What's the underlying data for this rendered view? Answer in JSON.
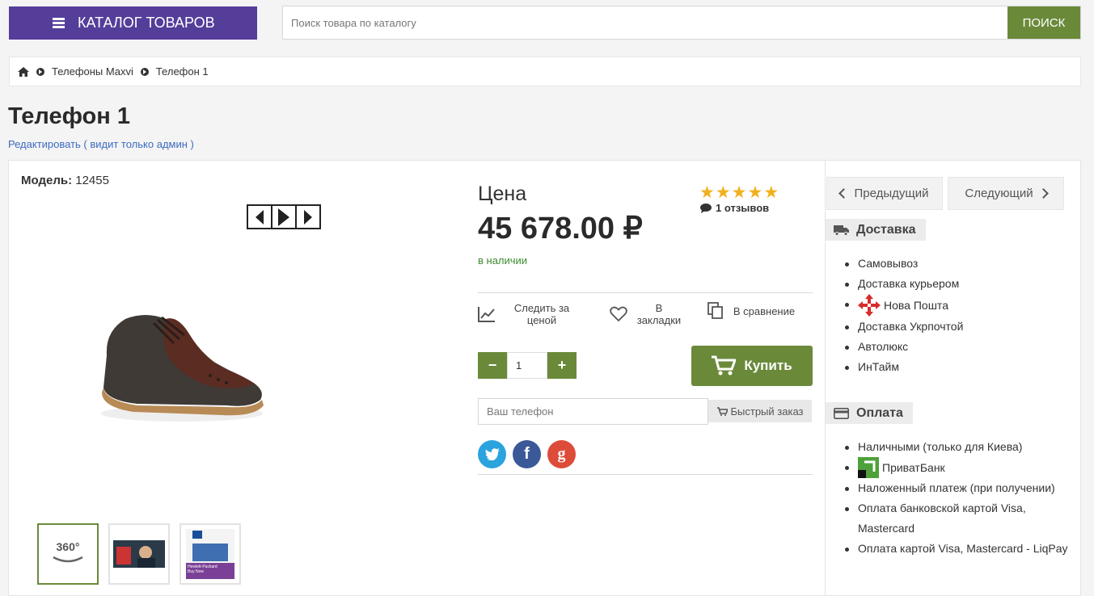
{
  "header": {
    "catalog_label": "КАТАЛОГ ТОВАРОВ",
    "search_placeholder": "Поиск товара по каталогу",
    "search_button": "ПОИСК"
  },
  "breadcrumb": {
    "items": [
      "Телефоны Maxvi",
      "Телефон 1"
    ]
  },
  "product": {
    "title": "Телефон 1",
    "edit_link": "Редактировать ( видит только админ )",
    "model_label": "Модель:",
    "model_value": "12455",
    "price_label": "Цена",
    "price_value": "45 678.00 ₽",
    "rating_stars": 5,
    "reviews_text": "1 отзывов",
    "stock_status": "в наличии",
    "quantity": "1"
  },
  "actions": {
    "track_price": "Следить за ценой",
    "bookmark": "В закладки",
    "compare": "В сравнение",
    "buy": "Купить",
    "phone_placeholder": "Ваш телефон",
    "quick_order": "Быстрый заказ"
  },
  "thumbnails": [
    {
      "label": "360°",
      "icon": "rotate-360-icon"
    },
    {
      "label": "",
      "icon": "photo-thumb"
    },
    {
      "label": "Hewlett-Packard",
      "sublabel": "Buy Now",
      "icon": "hp-thumb"
    }
  ],
  "navigation": {
    "prev": "Предыдущий",
    "next": "Следующий"
  },
  "delivery": {
    "title": "Доставка",
    "items": [
      "Самовывоз",
      "Доставка курьером",
      "Нова Пошта",
      "Доставка Укрпочтой",
      "Автолюкс",
      "ИнТайм"
    ]
  },
  "payment": {
    "title": "Оплата",
    "items": [
      "Наличными (только для Киева)",
      "ПриватБанк",
      "Наложенный платеж (при получении)",
      "Оплата банковской картой Visa, Mastercard",
      "Оплата картой Visa, Mastercard - LiqPay"
    ]
  },
  "colors": {
    "accent_purple": "#553d9a",
    "accent_green": "#6a8a3a",
    "star": "#f2b01e",
    "stock_green": "#3c8a2f",
    "link_blue": "#3d6bc1"
  }
}
